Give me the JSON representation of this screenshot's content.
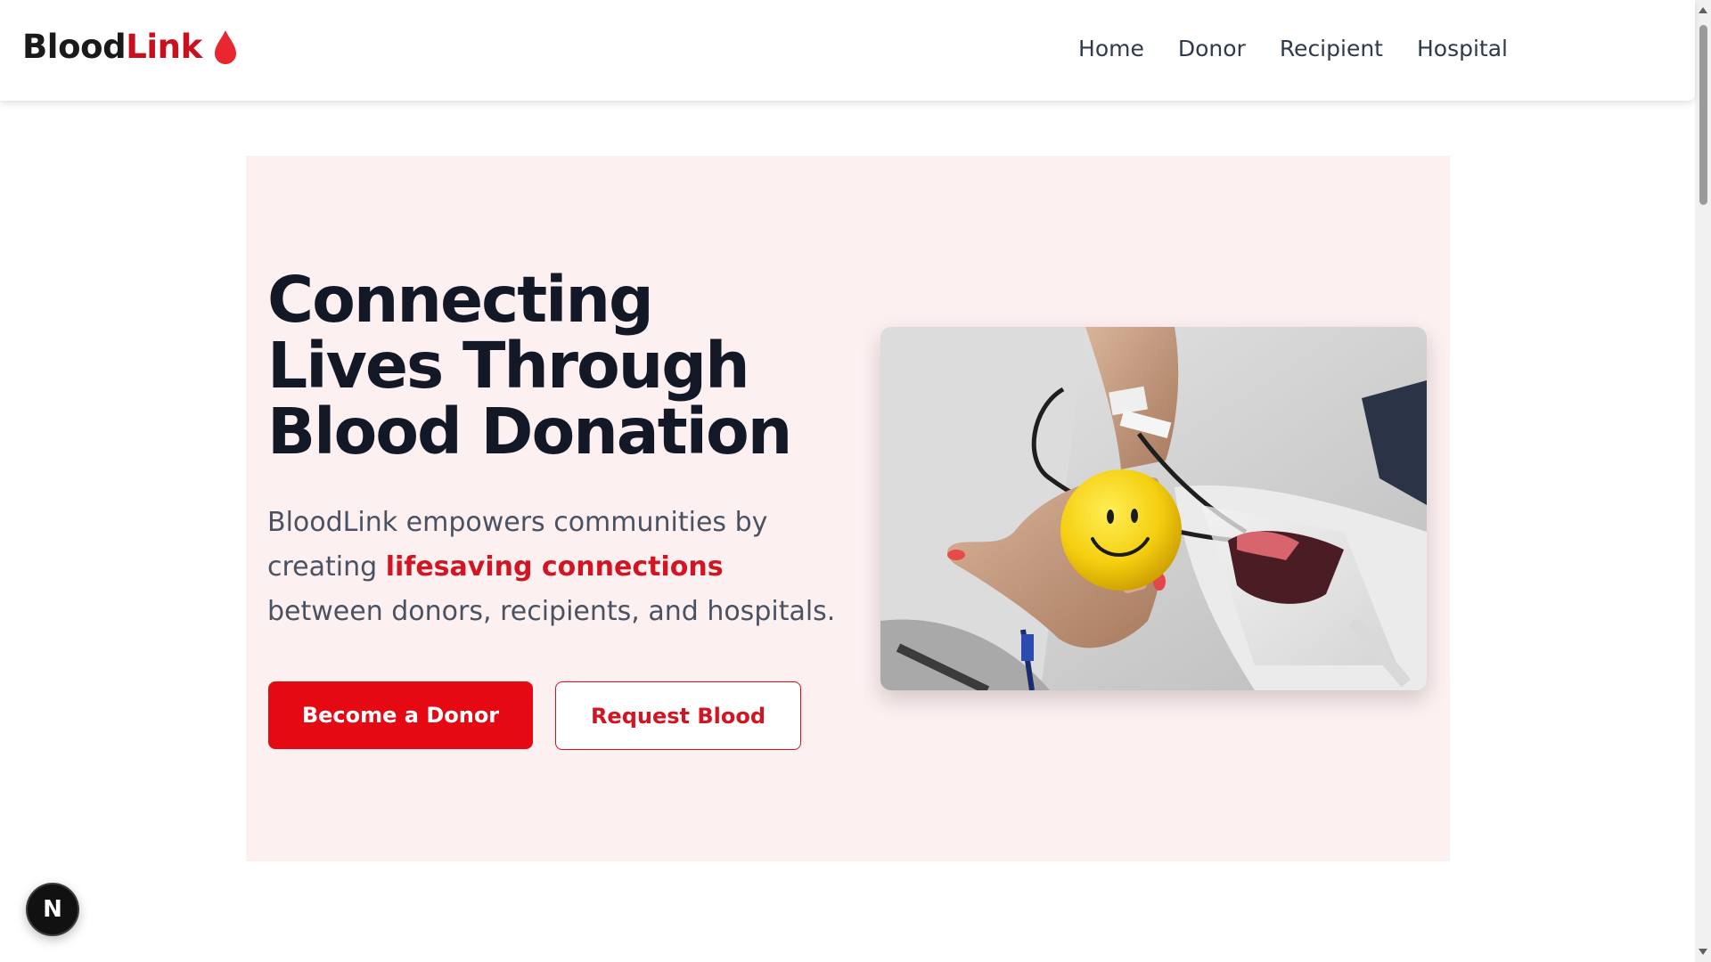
{
  "brand": {
    "name_part1": "Blood",
    "name_part2": "Link",
    "icon": "blood-drop-icon"
  },
  "nav": {
    "items": [
      {
        "label": "Home"
      },
      {
        "label": "Donor"
      },
      {
        "label": "Recipient"
      },
      {
        "label": "Hospital"
      }
    ]
  },
  "hero": {
    "title": "Connecting Lives Through Blood Donation",
    "desc_before": "BloodLink empowers communities by creating ",
    "desc_highlight": "lifesaving connections",
    "desc_after": " between donors, recipients, and hospitals.",
    "primary_button": "Become a Donor",
    "secondary_button": "Request Blood",
    "image_alt": "Hand holding a yellow smiley stress ball while donating blood"
  },
  "dev_indicator": {
    "label": "N"
  },
  "colors": {
    "brand_red": "#e50914",
    "text_dark": "#121826",
    "hero_bg": "#fdf0f1"
  }
}
